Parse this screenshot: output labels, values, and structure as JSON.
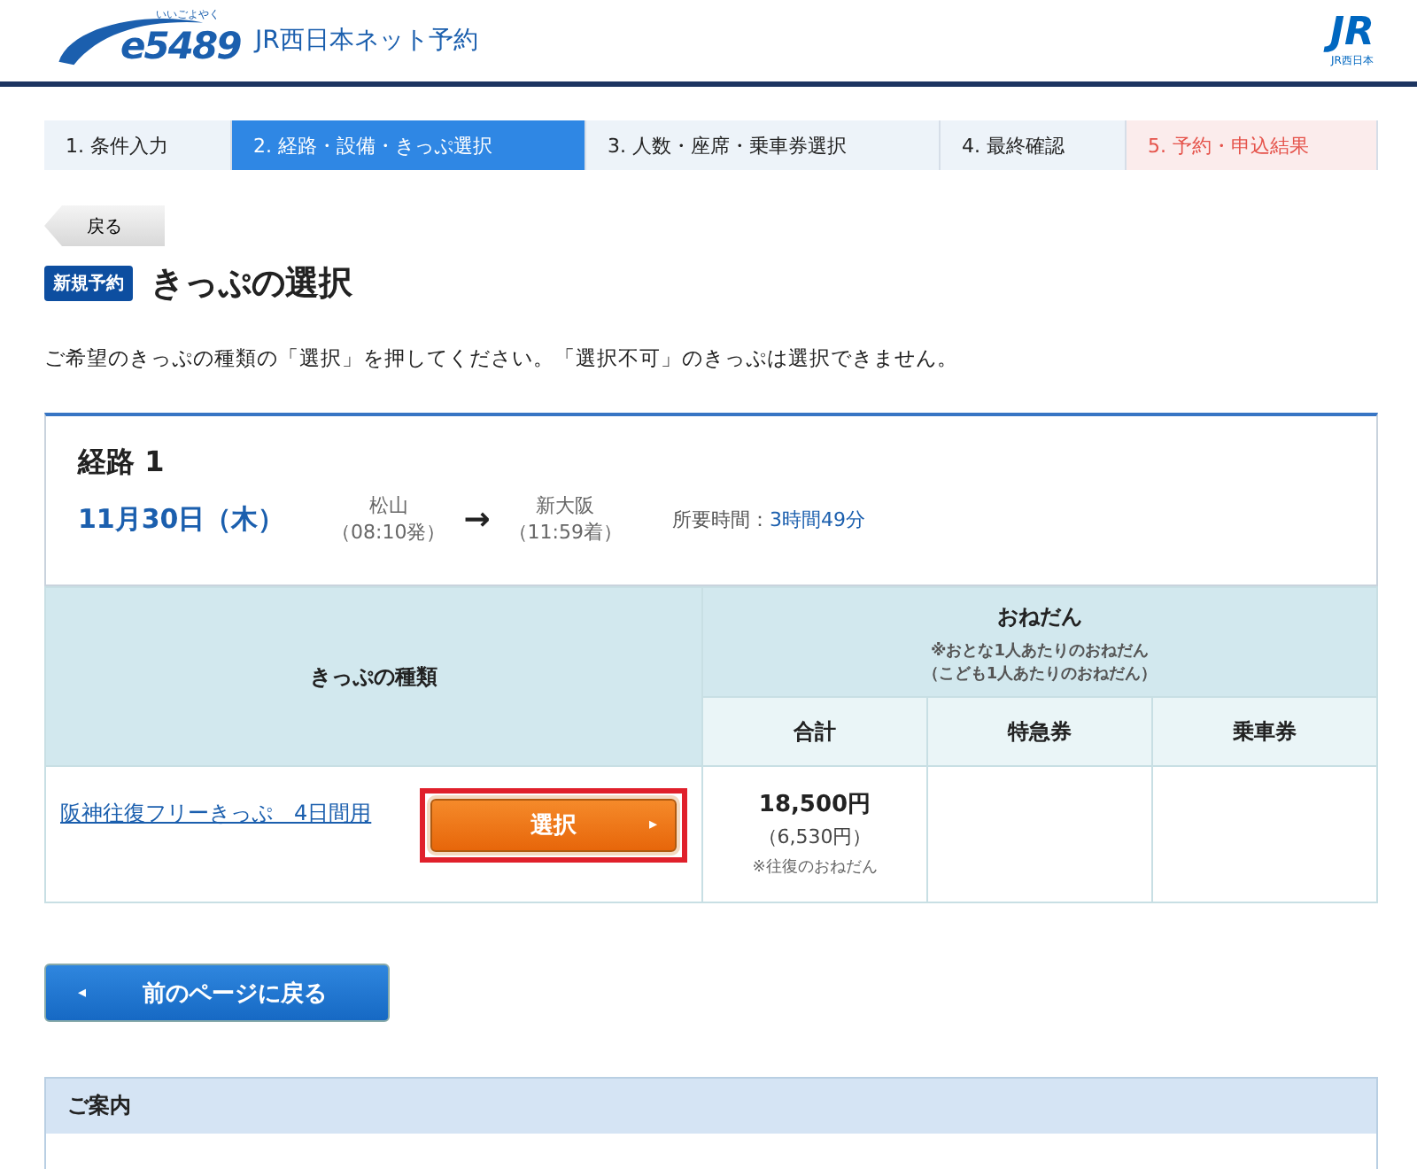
{
  "header": {
    "logo_text": "e5489",
    "logo_ruby": "いいごよやく",
    "site_title": "JR西日本ネット予約",
    "brand_logo_text": "JR",
    "brand_logo_caption": "JR西日本"
  },
  "steps": [
    {
      "label": "1. 条件入力",
      "selected": false,
      "kind": "normal"
    },
    {
      "label": "2. 経路・設備・きっぷ選択",
      "selected": true,
      "kind": "normal"
    },
    {
      "label": "3. 人数・座席・乗車券選択",
      "selected": false,
      "kind": "normal"
    },
    {
      "label": "4. 最終確認",
      "selected": false,
      "kind": "normal"
    },
    {
      "label": "5. 予約・申込結果",
      "selected": false,
      "kind": "result"
    }
  ],
  "back_button": "戻る",
  "page_title": {
    "badge": "新規予約",
    "title": "きっぷの選択"
  },
  "instruction": "ご希望のきっぷの種類の「選択」を押してください。「選択不可」のきっぷは選択できません。",
  "route": {
    "heading": "経路 1",
    "date": "11月30日（木）",
    "from": {
      "station": "松山",
      "time": "（08:10発）"
    },
    "arrow": "→",
    "to": {
      "station": "新大阪",
      "time": "（11:59着）"
    },
    "duration_label": "所要時間：",
    "duration": "3時間49分"
  },
  "table": {
    "ticket_type_header": "きっぷの種類",
    "price_header": "おねだん",
    "price_note_1": "※おとな1人あたりのおねだん",
    "price_note_2": "（こども1人あたりのおねだん）",
    "price_columns": [
      "合計",
      "特急券",
      "乗車券"
    ],
    "rows": [
      {
        "ticket": "阪神往復フリーきっぷ　4日間用",
        "select_button": "選択",
        "button_arrow": "▸",
        "highlighted": true,
        "total": "18,500円",
        "child_total": "（6,530円）",
        "note": "※往復のおねだん"
      }
    ]
  },
  "prev_page_button": {
    "arrow": "◂",
    "label": "前のページに戻る"
  },
  "info_panel": {
    "title": "ご案内"
  }
}
